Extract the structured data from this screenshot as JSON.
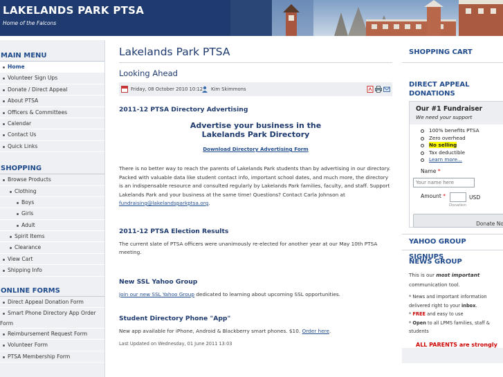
{
  "header": {
    "title": "LAKELANDS PARK PTSA",
    "tagline": "Home of the Falcons"
  },
  "left": {
    "main_menu": {
      "title": "MAIN MENU",
      "items": [
        "Home",
        "Volunteer Sign Ups",
        "Donate / Direct Appeal",
        "About PTSA",
        "Officers & Committees",
        "Calendar",
        "Contact Us",
        "Quick Links"
      ]
    },
    "shopping": {
      "title": "SHOPPING",
      "items": [
        "Browse Products",
        "Clothing",
        "Boys",
        "Girls",
        "Adult",
        "Spirit Items",
        "Clearance",
        "View Cart",
        "Shipping Info"
      ]
    },
    "online_forms": {
      "title": "ONLINE FORMS",
      "items": [
        "Direct Appeal Donation Form",
        "Smart Phone Directory App Order Form",
        "Reimbursement Request Form",
        "Volunteer Form",
        "PTSA Membership Form"
      ]
    }
  },
  "main": {
    "page_title": "Lakelands Park PTSA",
    "article_title": "Looking Ahead",
    "meta": {
      "date": "Friday, 08 October 2010 10:12",
      "author": "Kim Skimmons",
      "icons": [
        "pdf-icon",
        "print-icon",
        "email-icon"
      ]
    },
    "sections": {
      "directory": {
        "heading": "2011-12 PTSA Directory Advertising",
        "ad_headline_1": "Advertise your business in the",
        "ad_headline_2": "Lakelands Park Directory",
        "download_link": "Download Directory Advertising Form",
        "body": "There is no better way to reach the parents of Lakelands Park students than by advertising in our directory. Packed with valuable data like student contact info, important school dates, and much more, the directory is an indispensable resource and consulted regularly by Lakelands Park families, faculty, and staff.  Support Lakelands Park and your business at the same time!  Questions?  Contact Carla Johnson at",
        "email": "fundraising@lakelandsparkptsa.org",
        "email_suffix": "."
      },
      "election": {
        "heading": "2011-12 PTSA Election Results",
        "body": "The current slate of PTSA officers were unanimously re-elected for another year at our May 10th PTSA meeting."
      },
      "yahoo": {
        "heading": "New SSL Yahoo Group",
        "link": "Join our new SSL Yahoo Group",
        "body": " dedicated to learning about upcoming SSL opportunities."
      },
      "app": {
        "heading": "Student Directory Phone \"App\"",
        "body": "New app available for iPhone, Android & Blackberry smart phones.  $10.  ",
        "link": "Order here",
        "link_suffix": "."
      }
    },
    "last_updated": "Last Updated on Wednesday, 01 June 2011 13:03"
  },
  "right": {
    "cart_title": "SHOPPING CART",
    "appeal_title_1": "DIRECT APPEAL",
    "appeal_title_2": "DONATIONS",
    "fundraiser": {
      "title": "Our #1 Fundraiser",
      "subtitle": "We need your support",
      "bullets": [
        "100% benefits PTSA",
        "Zero overhead",
        "No selling",
        "Tax deductible",
        "Learn more..."
      ],
      "name_label": "Name",
      "name_placeholder": "Your name here",
      "amount_label": "Amount",
      "currency": "USD",
      "donation_note": "Donation",
      "button_label": "Donate No"
    },
    "yahoo_title": "YAHOO GROUP SIGNUPS",
    "news_title": "NEWS GROUP",
    "news_intro_1": "This is our ",
    "news_intro_em": "most important",
    "news_intro_2": "communication tool.",
    "news_items": {
      "a1": "* News and important information",
      "a2": "delivered right to your ",
      "a2b": "inbox",
      "a2c": ".",
      "b_star": "* ",
      "b_red": "FREE",
      "b_rest": " and easy to use",
      "c_star": "* ",
      "c_bold": "Open",
      "c_rest": " to all LPMS families, staff &",
      "c2": "students"
    },
    "parents_text": "ALL PARENTS are strongly"
  },
  "colors": {
    "navy": "#1e3a6e",
    "link": "#1e4a8c",
    "highlight": "#ffff00",
    "red": "#cc0000"
  }
}
